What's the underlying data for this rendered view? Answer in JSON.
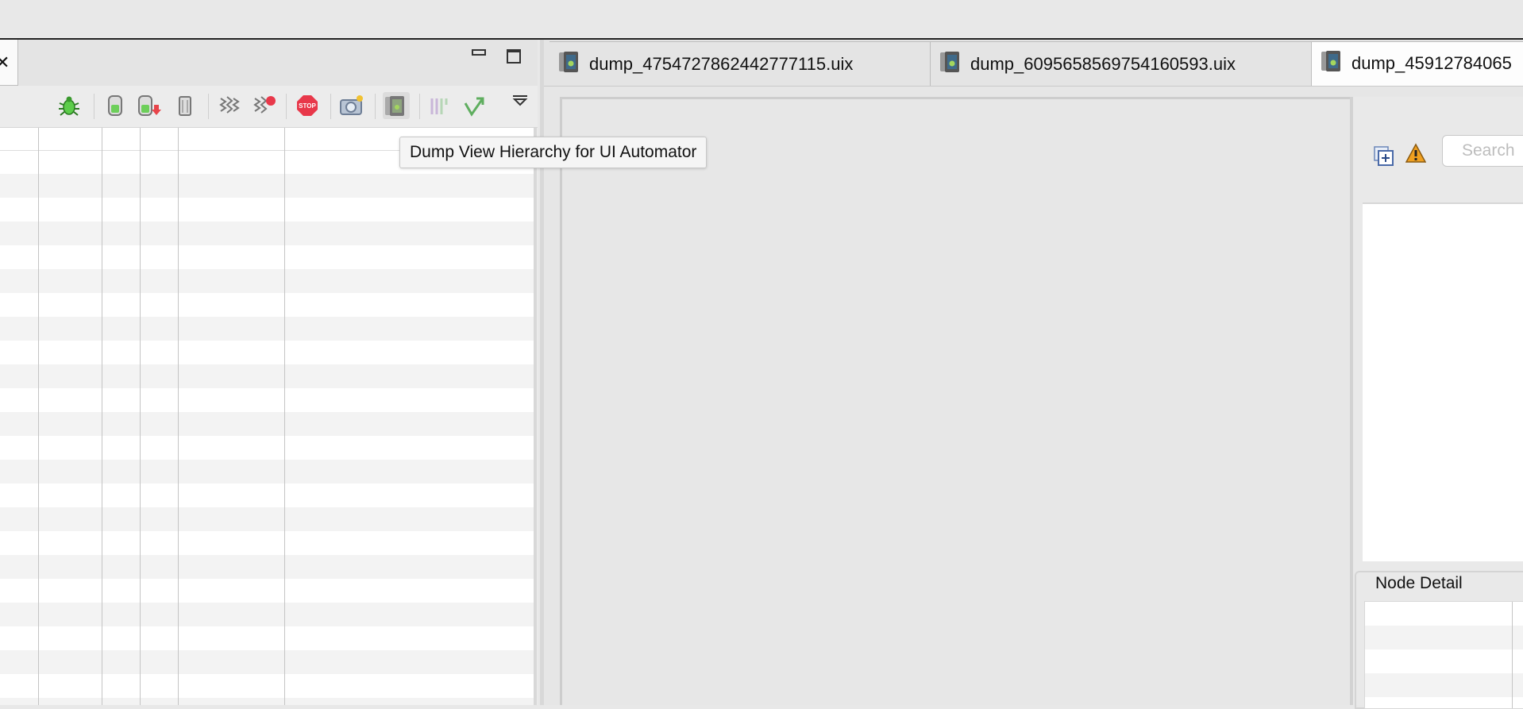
{
  "left_view": {
    "toolbar": {
      "icons": [
        "debug-icon",
        "update-heap-icon",
        "dump-hprof-icon",
        "cause-gc-icon",
        "update-threads-icon",
        "start-method-profiling-icon",
        "stop-process-icon",
        "screen-capture-icon",
        "dump-view-hierarchy-icon",
        "systrace-icon",
        "opengl-trace-icon",
        "view-menu-icon"
      ]
    },
    "table": {
      "row_count": 24
    }
  },
  "tooltip": {
    "text": "Dump View Hierarchy for UI Automator"
  },
  "editor": {
    "tabs": [
      {
        "label": "dump_4754727862442777115.uix",
        "active": false
      },
      {
        "label": "dump_6095658569754160593.uix",
        "active": false
      },
      {
        "label": "dump_45912784065",
        "active": true
      }
    ]
  },
  "right_panel": {
    "search": {
      "placeholder": "Search",
      "value": ""
    },
    "node_detail": {
      "title": "Node Detail"
    }
  },
  "colors": {
    "tab_active": "#fdfdfd",
    "tab_inactive": "#e4e4e4",
    "row_alt": "#f3f3f3",
    "warning": "#f0a020",
    "stop": "#e8384a"
  }
}
